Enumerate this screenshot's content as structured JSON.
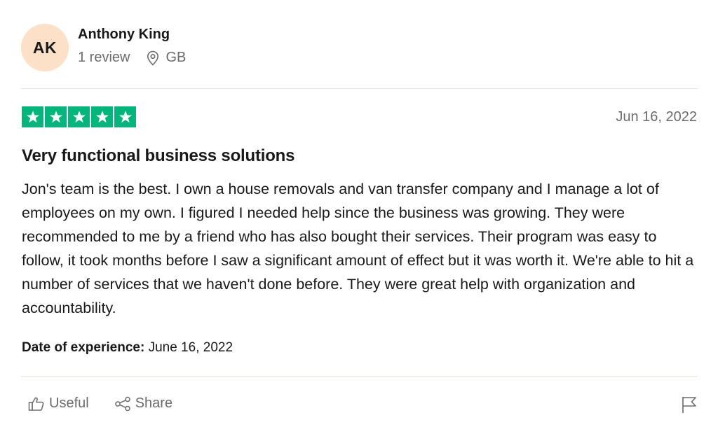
{
  "reviewer": {
    "initials": "AK",
    "avatar_color": "#fde0c8",
    "name": "Anthony King",
    "review_count": "1 review",
    "location_icon": "location-pin-icon",
    "country": "GB"
  },
  "rating": {
    "stars": 5,
    "max_stars": 5,
    "color": "#00b67a"
  },
  "review": {
    "date": "Jun 16, 2022",
    "title": "Very functional business solutions",
    "body": "Jon's team is the best. I own a house removals and van transfer company and I manage a lot of employees on my own. I figured I needed help since the business was growing. They were recommended to me by a friend who has also bought their services. Their program was easy to follow, it took months before I saw a significant amount of effect but it was worth it. We're able to hit a number of services that we haven't done before. They were great help with organization and accountability.",
    "experience_label": "Date of experience:",
    "experience_date": "June 16, 2022"
  },
  "actions": {
    "useful_label": "Useful",
    "useful_icon": "thumbs-up-icon",
    "share_label": "Share",
    "share_icon": "share-icon",
    "flag_icon": "flag-icon"
  }
}
